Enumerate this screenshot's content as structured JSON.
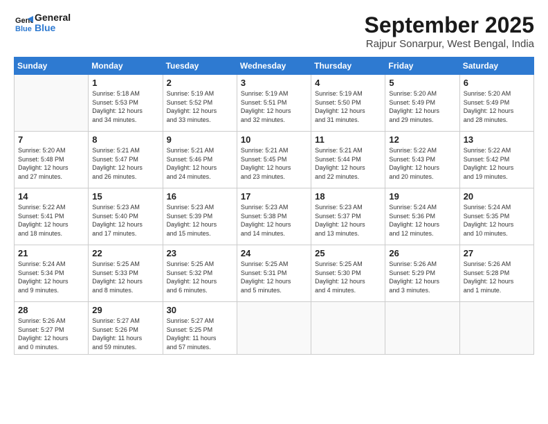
{
  "logo": {
    "line1": "General",
    "line2": "Blue"
  },
  "title": "September 2025",
  "location": "Rajpur Sonarpur, West Bengal, India",
  "days_header": [
    "Sunday",
    "Monday",
    "Tuesday",
    "Wednesday",
    "Thursday",
    "Friday",
    "Saturday"
  ],
  "weeks": [
    [
      {
        "num": "",
        "info": ""
      },
      {
        "num": "1",
        "info": "Sunrise: 5:18 AM\nSunset: 5:53 PM\nDaylight: 12 hours\nand 34 minutes."
      },
      {
        "num": "2",
        "info": "Sunrise: 5:19 AM\nSunset: 5:52 PM\nDaylight: 12 hours\nand 33 minutes."
      },
      {
        "num": "3",
        "info": "Sunrise: 5:19 AM\nSunset: 5:51 PM\nDaylight: 12 hours\nand 32 minutes."
      },
      {
        "num": "4",
        "info": "Sunrise: 5:19 AM\nSunset: 5:50 PM\nDaylight: 12 hours\nand 31 minutes."
      },
      {
        "num": "5",
        "info": "Sunrise: 5:20 AM\nSunset: 5:49 PM\nDaylight: 12 hours\nand 29 minutes."
      },
      {
        "num": "6",
        "info": "Sunrise: 5:20 AM\nSunset: 5:49 PM\nDaylight: 12 hours\nand 28 minutes."
      }
    ],
    [
      {
        "num": "7",
        "info": "Sunrise: 5:20 AM\nSunset: 5:48 PM\nDaylight: 12 hours\nand 27 minutes."
      },
      {
        "num": "8",
        "info": "Sunrise: 5:21 AM\nSunset: 5:47 PM\nDaylight: 12 hours\nand 26 minutes."
      },
      {
        "num": "9",
        "info": "Sunrise: 5:21 AM\nSunset: 5:46 PM\nDaylight: 12 hours\nand 24 minutes."
      },
      {
        "num": "10",
        "info": "Sunrise: 5:21 AM\nSunset: 5:45 PM\nDaylight: 12 hours\nand 23 minutes."
      },
      {
        "num": "11",
        "info": "Sunrise: 5:21 AM\nSunset: 5:44 PM\nDaylight: 12 hours\nand 22 minutes."
      },
      {
        "num": "12",
        "info": "Sunrise: 5:22 AM\nSunset: 5:43 PM\nDaylight: 12 hours\nand 20 minutes."
      },
      {
        "num": "13",
        "info": "Sunrise: 5:22 AM\nSunset: 5:42 PM\nDaylight: 12 hours\nand 19 minutes."
      }
    ],
    [
      {
        "num": "14",
        "info": "Sunrise: 5:22 AM\nSunset: 5:41 PM\nDaylight: 12 hours\nand 18 minutes."
      },
      {
        "num": "15",
        "info": "Sunrise: 5:23 AM\nSunset: 5:40 PM\nDaylight: 12 hours\nand 17 minutes."
      },
      {
        "num": "16",
        "info": "Sunrise: 5:23 AM\nSunset: 5:39 PM\nDaylight: 12 hours\nand 15 minutes."
      },
      {
        "num": "17",
        "info": "Sunrise: 5:23 AM\nSunset: 5:38 PM\nDaylight: 12 hours\nand 14 minutes."
      },
      {
        "num": "18",
        "info": "Sunrise: 5:23 AM\nSunset: 5:37 PM\nDaylight: 12 hours\nand 13 minutes."
      },
      {
        "num": "19",
        "info": "Sunrise: 5:24 AM\nSunset: 5:36 PM\nDaylight: 12 hours\nand 12 minutes."
      },
      {
        "num": "20",
        "info": "Sunrise: 5:24 AM\nSunset: 5:35 PM\nDaylight: 12 hours\nand 10 minutes."
      }
    ],
    [
      {
        "num": "21",
        "info": "Sunrise: 5:24 AM\nSunset: 5:34 PM\nDaylight: 12 hours\nand 9 minutes."
      },
      {
        "num": "22",
        "info": "Sunrise: 5:25 AM\nSunset: 5:33 PM\nDaylight: 12 hours\nand 8 minutes."
      },
      {
        "num": "23",
        "info": "Sunrise: 5:25 AM\nSunset: 5:32 PM\nDaylight: 12 hours\nand 6 minutes."
      },
      {
        "num": "24",
        "info": "Sunrise: 5:25 AM\nSunset: 5:31 PM\nDaylight: 12 hours\nand 5 minutes."
      },
      {
        "num": "25",
        "info": "Sunrise: 5:25 AM\nSunset: 5:30 PM\nDaylight: 12 hours\nand 4 minutes."
      },
      {
        "num": "26",
        "info": "Sunrise: 5:26 AM\nSunset: 5:29 PM\nDaylight: 12 hours\nand 3 minutes."
      },
      {
        "num": "27",
        "info": "Sunrise: 5:26 AM\nSunset: 5:28 PM\nDaylight: 12 hours\nand 1 minute."
      }
    ],
    [
      {
        "num": "28",
        "info": "Sunrise: 5:26 AM\nSunset: 5:27 PM\nDaylight: 12 hours\nand 0 minutes."
      },
      {
        "num": "29",
        "info": "Sunrise: 5:27 AM\nSunset: 5:26 PM\nDaylight: 11 hours\nand 59 minutes."
      },
      {
        "num": "30",
        "info": "Sunrise: 5:27 AM\nSunset: 5:25 PM\nDaylight: 11 hours\nand 57 minutes."
      },
      {
        "num": "",
        "info": ""
      },
      {
        "num": "",
        "info": ""
      },
      {
        "num": "",
        "info": ""
      },
      {
        "num": "",
        "info": ""
      }
    ]
  ]
}
